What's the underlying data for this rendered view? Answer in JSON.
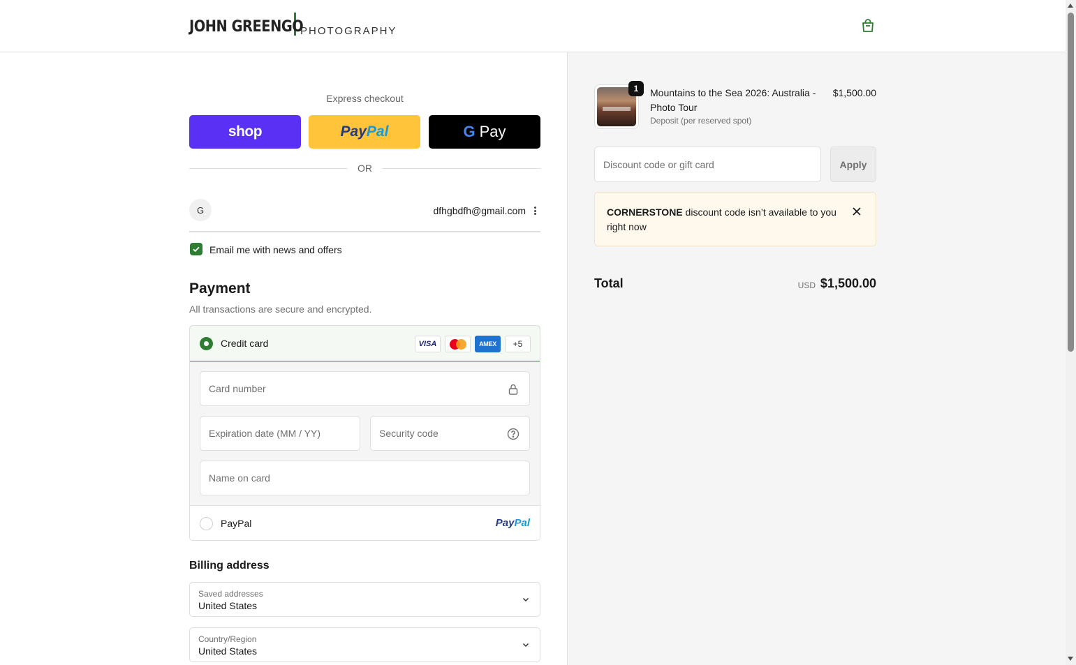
{
  "header": {
    "brand_name": "JOHN GREENGO",
    "brand_sub": "PHOTOGRAPHY",
    "cart_icon": "shopping-bag-icon"
  },
  "express": {
    "label": "Express checkout",
    "shop_label": "shop",
    "paypal_part1": "Pay",
    "paypal_part2": "Pal",
    "gpay_g": "G",
    "gpay_label": "Pay",
    "or_label": "OR"
  },
  "account": {
    "avatar_initial": "G",
    "email": "dfhgbdfh@gmail.com",
    "marketing_label": "Email me with news and offers",
    "marketing_checked": true
  },
  "payment": {
    "title": "Payment",
    "subtitle": "All transactions are secure and encrypted.",
    "credit_card_label": "Credit card",
    "card_brands": [
      "VISA",
      "Mastercard",
      "AMEX",
      "+5"
    ],
    "card_number_placeholder": "Card number",
    "expiration_placeholder": "Expiration date (MM / YY)",
    "security_placeholder": "Security code",
    "name_placeholder": "Name on card",
    "paypal_label": "PayPal",
    "paypal_logo_1": "Pay",
    "paypal_logo_2": "Pal"
  },
  "billing": {
    "title": "Billing address",
    "saved_caption": "Saved addresses",
    "saved_value": "United States",
    "country_caption": "Country/Region",
    "country_value": "United States"
  },
  "order": {
    "item_name": "Mountains to the Sea 2026: Australia - Photo Tour",
    "item_variant": "Deposit (per reserved spot)",
    "item_price": "$1,500.00",
    "item_qty": "1",
    "discount_placeholder": "Discount code or gift card",
    "apply_label": "Apply",
    "notice_code": "CORNERSTONE",
    "notice_text": " discount code isn’t available to you right now",
    "total_label": "Total",
    "total_currency": "USD",
    "total_amount": "$1,500.00"
  },
  "colors": {
    "accent": "#2e7d32",
    "shop_purple": "#5a31f4",
    "paypal_yellow": "#ffc439",
    "notice_bg": "#fff8ec"
  }
}
